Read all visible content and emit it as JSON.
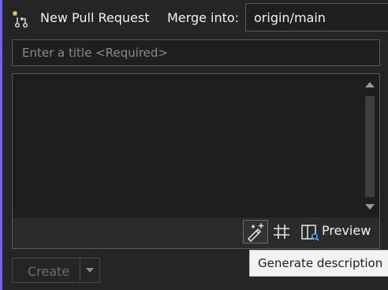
{
  "header": {
    "title": "New Pull Request",
    "merge_label": "Merge into:",
    "target_branch": "origin/main"
  },
  "form": {
    "title_placeholder": "Enter a title <Required>",
    "description_value": ""
  },
  "toolbar": {
    "generate_icon": "magic-wand-icon",
    "hash_icon": "hash-icon",
    "preview_label": "Preview"
  },
  "actions": {
    "create_label": "Create"
  },
  "tooltip": {
    "text": "Generate description"
  },
  "colors": {
    "accent": "#7160e8",
    "background": "#252526",
    "input_background": "#1f1f1f",
    "border": "#5a5a5a",
    "tooltip_background": "#f2f2f2"
  }
}
